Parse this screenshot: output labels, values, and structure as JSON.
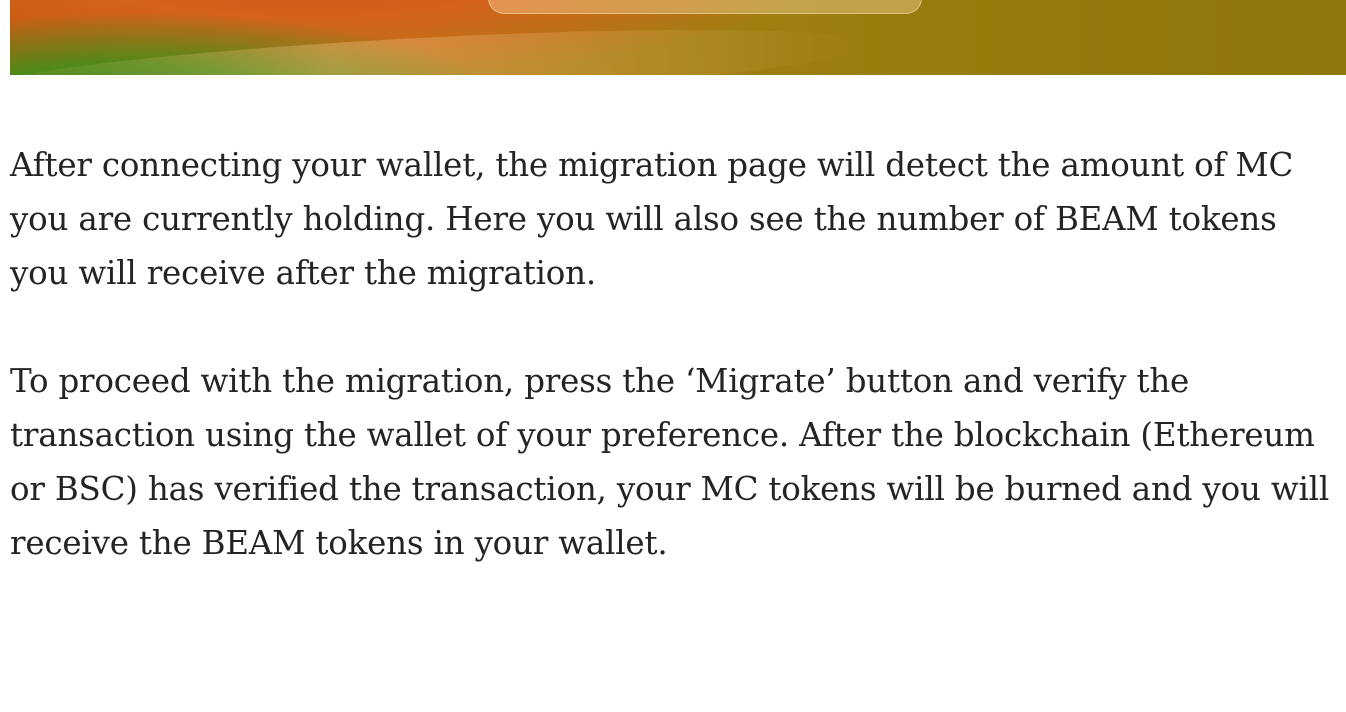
{
  "article": {
    "paragraphs": [
      "After connecting your wallet, the migration page will detect the amount of MC you are currently holding. Here you will also see the number of BEAM tokens you will receive after the migration.",
      "To proceed with the migration, press the ‘Migrate’ button and verify the transaction using the wallet of your preference. After the blockchain (Ethereum or BSC) has verified the transaction, your MC tokens will be burned and you will receive the BEAM tokens in your wallet."
    ]
  }
}
